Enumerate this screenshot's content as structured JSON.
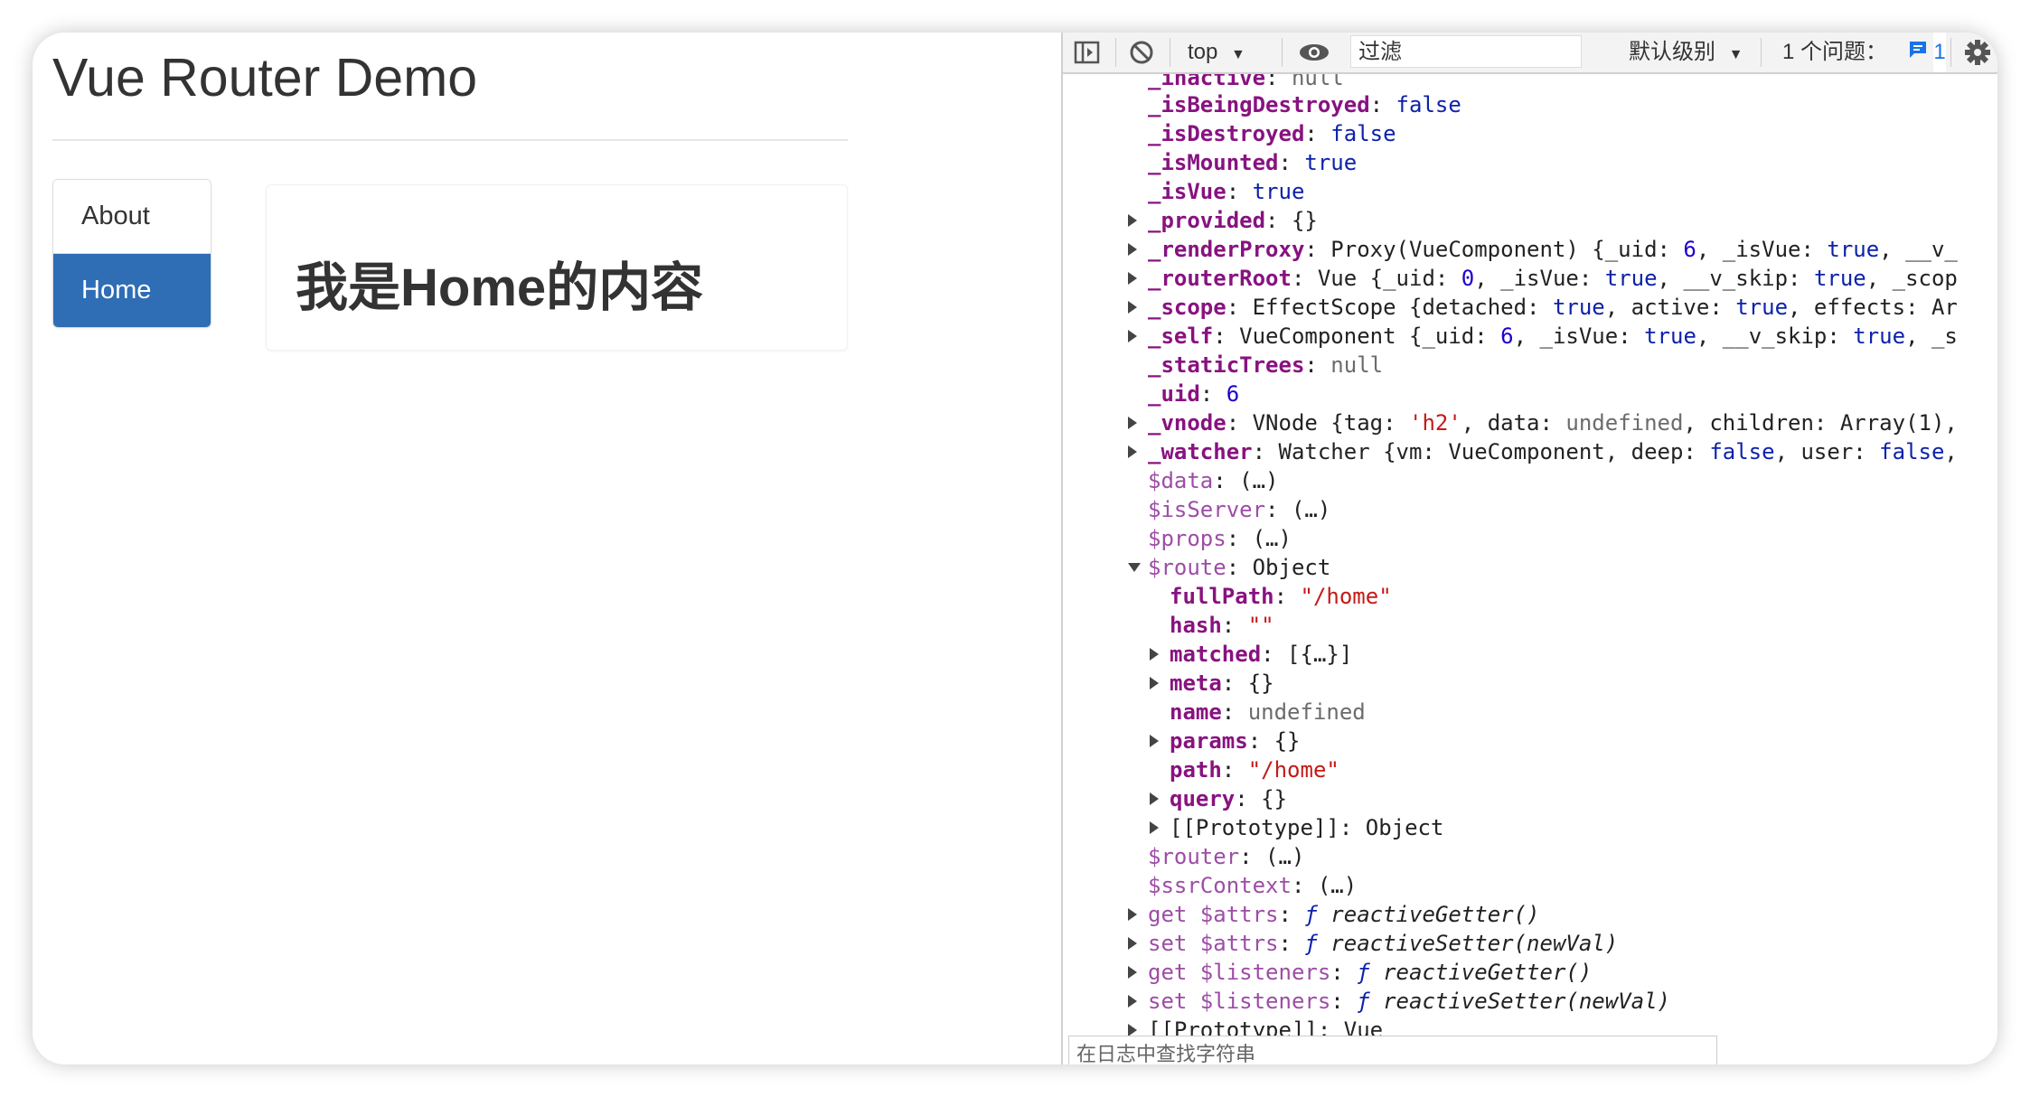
{
  "app": {
    "title": "Vue Router Demo",
    "nav": [
      {
        "label": "About",
        "active": false
      },
      {
        "label": "Home",
        "active": true
      }
    ],
    "content_heading": "我是Home的内容",
    "accent": "#2f6db5"
  },
  "devtools": {
    "toolbar": {
      "context": "top",
      "filter_placeholder": "过滤",
      "level": "默认级别",
      "issues_label": "1 个问题：",
      "issues_count": "1"
    },
    "search_placeholder": "在日志中查找字符串"
  }
}
